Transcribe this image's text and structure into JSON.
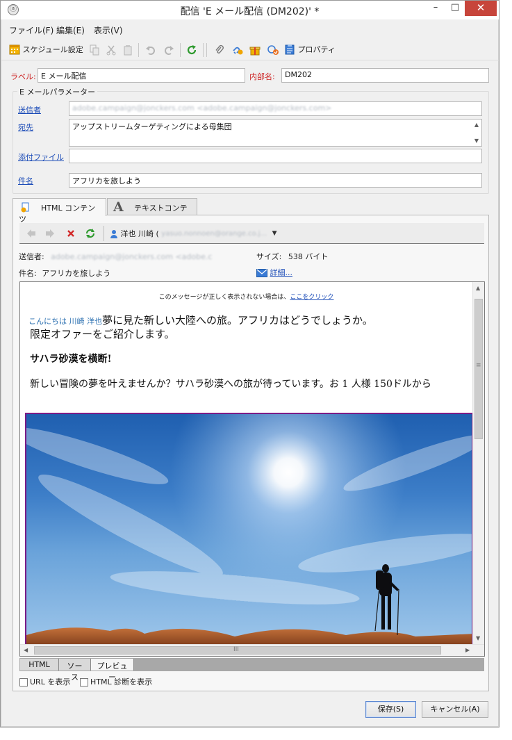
{
  "window": {
    "title": "配信 'E メール配信 (DM202)' *",
    "app_icon": "ⓐ",
    "minimize": "–",
    "maximize": "□",
    "close": "✕"
  },
  "menu": [
    "ファイル(F)",
    "編集(E)",
    "表示(V)"
  ],
  "toolbar": {
    "schedule_label": "スケジュール設定",
    "properties_label": "プロパティ"
  },
  "header": {
    "label_caption": "ラベル:",
    "label_value": "E メール配信",
    "internal_caption": "内部名:",
    "internal_value": "DM202"
  },
  "params": {
    "group_title": "E メールパラメーター",
    "sender_link": "送信者",
    "sender_value": "adobe.campaign@jonckers.com <adobe.campaign@jonckers.com>",
    "to_link": "宛先",
    "to_value": "アップストリームターゲティングによる母集団",
    "attach_link": "添付ファイル",
    "attach_value": "",
    "subject_link": "件名",
    "subject_value": "アフリカを旅しよう"
  },
  "tabs": {
    "html": "HTML コンテンツ",
    "text": "テキストコンテンツ"
  },
  "navbar": {
    "recipient_name": "洋也 川崎 (",
    "recipient_email": "yasuo.nonnoen@orange.co.j..."
  },
  "info": {
    "sender_caption": "送信者:",
    "sender_value": "adobe.campaign@jonckers.com <adobe.c",
    "size_caption": "サイズ:",
    "size_value": "538 バイト",
    "subject_caption": "件名:",
    "subject_value": "アフリカを旅しよう",
    "details_link": "詳細..."
  },
  "preview": {
    "top_notice": "このメッセージが正しく表示されない場合は、",
    "top_link": "ここをクリック",
    "greeting_tag": "こんにちは 川崎 洋也",
    "greeting_text": "夢に見た新しい大陸への旅。アフリカはどうでしょうか。",
    "line2": "限定オファーをご紹介します。",
    "headline": "サハラ砂漠を横断!",
    "body": "新しい冒険の夢を叶えませんか？サハラ砂漠への旅が待っています。お 1 人様 150ドルから",
    "hscroll_grip": "III",
    "vscroll_grip": "≡"
  },
  "bottom_tabs": [
    "HTML",
    "ソース",
    "プレビュー"
  ],
  "options": {
    "show_url": "URL を表示",
    "show_diag": "HTML 診断を表示"
  },
  "buttons": {
    "save": "保存(S)",
    "cancel": "キャンセル(A)"
  },
  "colors": {
    "required_label": "#cc1f1f",
    "link": "#1d4db8",
    "close_button": "#c7453b",
    "hero_border": "#7b1b86"
  }
}
